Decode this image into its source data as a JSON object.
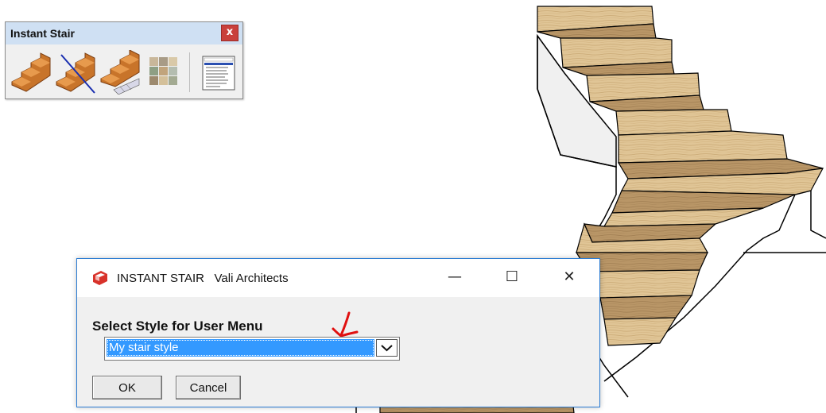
{
  "toolbar": {
    "title": "Instant Stair",
    "close_glyph": "x",
    "tools": [
      {
        "name": "straight-stair-tool-icon"
      },
      {
        "name": "stair-with-path-tool-icon"
      },
      {
        "name": "stair-on-grid-tool-icon"
      },
      {
        "name": "material-palette-tool-icon"
      },
      {
        "name": "style-menu-tool-icon"
      }
    ]
  },
  "dialog": {
    "title": "INSTANT STAIR   Vali Architects",
    "minimize_glyph": "—",
    "maximize_glyph": "☐",
    "close_glyph": "✕",
    "prompt_label": "Select Style for User Menu",
    "select_value": "My stair style",
    "ok_label": "OK",
    "cancel_label": "Cancel"
  },
  "colors": {
    "tread": "#e0c596",
    "riser": "#b99667",
    "stringer_outline": "#000000",
    "selection": "#3399ff",
    "annotation": "#e01010",
    "dialog_border": "#2b7cd3",
    "toolbar_title_bg": "#cfe0f3"
  }
}
